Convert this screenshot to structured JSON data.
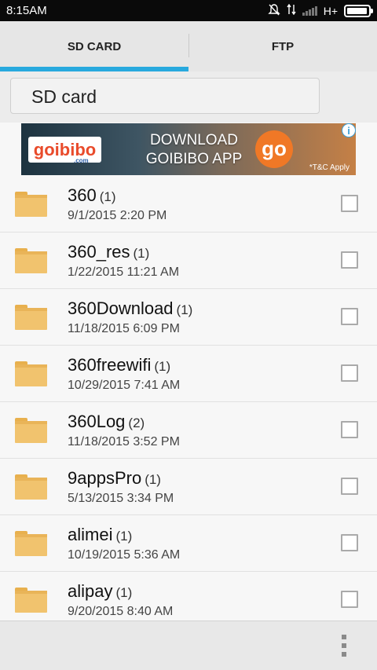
{
  "status_bar": {
    "time": "8:15AM",
    "network": "H+",
    "icons": [
      "mute-notification-icon",
      "data-transfer-icon",
      "signal-icon",
      "battery-icon"
    ],
    "battery_level": 0.95
  },
  "tabs": [
    {
      "label": "SD CARD",
      "selected": true
    },
    {
      "label": "FTP",
      "selected": false
    }
  ],
  "path": {
    "label": "SD card"
  },
  "ad": {
    "brand": "goibibo",
    "brand_sub": ".com",
    "headline_line1": "DOWNLOAD",
    "headline_line2": "GOIBIBO APP",
    "badge": "go",
    "footnote": "*T&C Apply",
    "info_icon": "i"
  },
  "files": [
    {
      "name": "360",
      "count": "(1)",
      "date": "9/1/2015 2:20 PM"
    },
    {
      "name": "360_res",
      "count": "(1)",
      "date": "1/22/2015 11:21 AM"
    },
    {
      "name": "360Download",
      "count": "(1)",
      "date": "11/18/2015 6:09 PM"
    },
    {
      "name": "360freewifi",
      "count": "(1)",
      "date": "10/29/2015 7:41 AM"
    },
    {
      "name": "360Log",
      "count": "(2)",
      "date": "11/18/2015 3:52 PM"
    },
    {
      "name": "9appsPro",
      "count": "(1)",
      "date": "5/13/2015 3:34 PM"
    },
    {
      "name": "alimei",
      "count": "(1)",
      "date": "10/19/2015 5:36 AM"
    },
    {
      "name": "alipay",
      "count": "(1)",
      "date": "9/20/2015 8:40 AM"
    }
  ],
  "colors": {
    "accent": "#28a9de",
    "folder": "#f1c36e"
  }
}
